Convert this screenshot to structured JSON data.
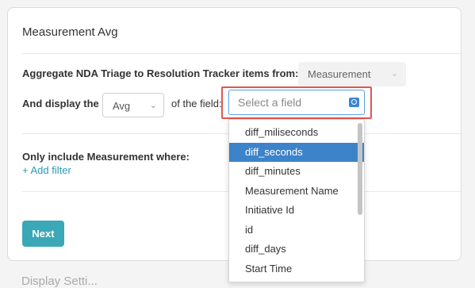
{
  "card": {
    "title": "Measurement Avg",
    "aggregate_label": "Aggregate NDA Triage to Resolution Tracker items from:",
    "source_select": "Measurement",
    "display_label": "And display the",
    "agg_select": "Avg",
    "of_field_label": "of the field:",
    "field_placeholder": "Select a field",
    "filter_label": "Only include Measurement where:",
    "add_filter": "+ Add filter",
    "next_button": "Next"
  },
  "dropdown": {
    "items": [
      "diff_miliseconds",
      "diff_seconds",
      "diff_minutes",
      "Measurement Name",
      "Initiative Id",
      "id",
      "diff_days",
      "Start Time"
    ],
    "selected_index": 1
  },
  "below_card_text": "Display Setti...",
  "colors": {
    "accent": "#3aa8b6",
    "link": "#2a9bb3",
    "selected": "#3d83c9",
    "highlight": "#e0574f"
  }
}
